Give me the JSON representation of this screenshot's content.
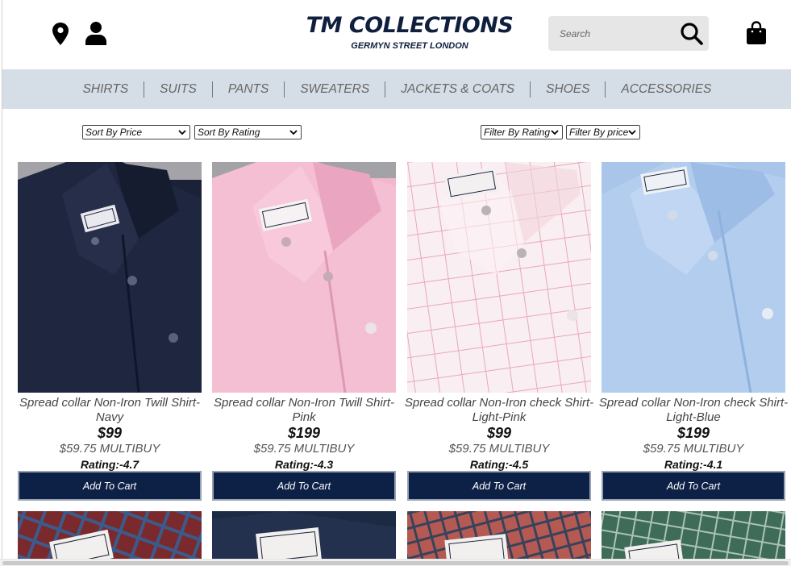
{
  "brand": {
    "title": "TM COLLECTIONS",
    "subtitle": "GERMYN STREET LONDON"
  },
  "header": {
    "search_placeholder": "Search",
    "icons": [
      "location-pin-icon",
      "user-icon",
      "search-icon",
      "shopping-bag-icon"
    ]
  },
  "nav": {
    "items": [
      "SHIRTS",
      "SUITS",
      "PANTS",
      "SWEATERS",
      "JACKETS & COATS",
      "SHOES",
      "ACCESSORIES"
    ]
  },
  "filters": {
    "sort_price": "Sort By Price",
    "sort_rating": "Sort By Rating",
    "filter_rating": "Filter By Rating",
    "filter_price": "Filter By price"
  },
  "products": [
    {
      "title": "Spread collar Non-Iron Twill Shirt-Navy",
      "price": "$99",
      "multibuy": "$59.75 MULTIBUY",
      "rating": "Rating:-4.7",
      "button": "Add To Cart",
      "color": "#1b2238"
    },
    {
      "title": "Spread collar Non-Iron Twill Shirt-Pink",
      "price": "$199",
      "multibuy": "$59.75 MULTIBUY",
      "rating": "Rating:-4.3",
      "button": "Add To Cart",
      "color": "#f2b6cd"
    },
    {
      "title": "Spread collar Non-Iron check Shirt-Light-Pink",
      "price": "$99",
      "multibuy": "$59.75 MULTIBUY",
      "rating": "Rating:-4.5",
      "button": "Add To Cart",
      "color": "#f7eaee"
    },
    {
      "title": "Spread collar Non-Iron check Shirt-Light-Blue",
      "price": "$199",
      "multibuy": "$59.75 MULTIBUY",
      "rating": "Rating:-4.1",
      "button": "Add To Cart",
      "color": "#a9c6ea"
    }
  ],
  "next_row_colors": [
    "#7a2a2c",
    "#1d2a44",
    "#b45a52",
    "#3f6b59"
  ],
  "colors": {
    "navy": "#0d2147",
    "nav_bg": "#d5dde6",
    "brand": "#0f1f3d"
  }
}
